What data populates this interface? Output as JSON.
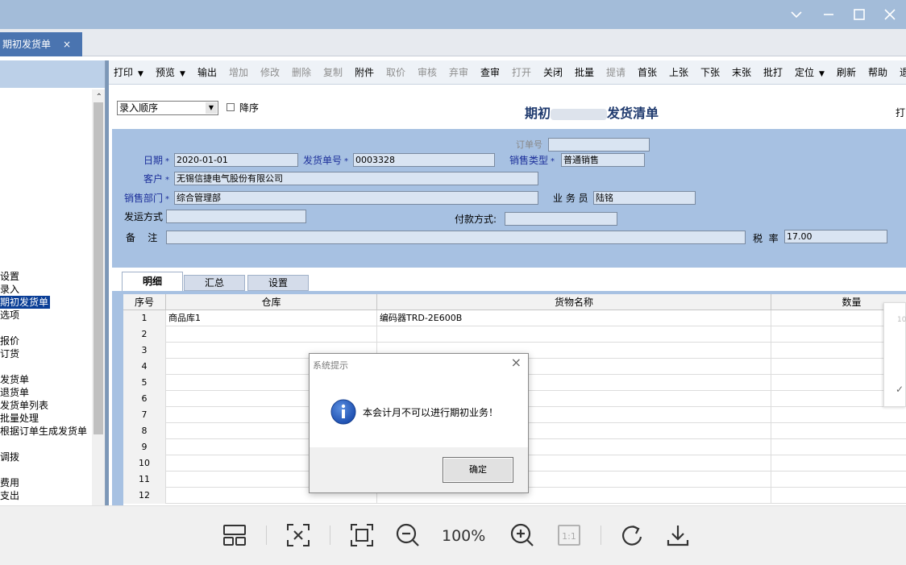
{
  "document_tab": {
    "label": "期初发货单",
    "close": "×"
  },
  "nav_items": [
    "设置",
    "录入",
    "期初发货单",
    "选项",
    "报价",
    "订货",
    "发货单",
    "退货单",
    "发货单列表",
    "批量处理",
    "根据订单生成发货单",
    "调拨",
    "费用",
    "支出"
  ],
  "nav_selected": "期初发货单",
  "toolbar": [
    {
      "label": "打印",
      "enabled": true,
      "dropdown": true
    },
    {
      "label": "预览",
      "enabled": true,
      "dropdown": true
    },
    {
      "label": "输出",
      "enabled": true
    },
    {
      "label": "增加",
      "enabled": false
    },
    {
      "label": "修改",
      "enabled": false
    },
    {
      "label": "删除",
      "enabled": false
    },
    {
      "label": "复制",
      "enabled": false
    },
    {
      "label": "附件",
      "enabled": true
    },
    {
      "label": "取价",
      "enabled": false
    },
    {
      "label": "审核",
      "enabled": false
    },
    {
      "label": "弃审",
      "enabled": false
    },
    {
      "label": "查审",
      "enabled": true
    },
    {
      "label": "打开",
      "enabled": false
    },
    {
      "label": "关闭",
      "enabled": true
    },
    {
      "label": "批量",
      "enabled": true
    },
    {
      "label": "提请",
      "enabled": false
    },
    {
      "label": "首张",
      "enabled": true
    },
    {
      "label": "上张",
      "enabled": true
    },
    {
      "label": "下张",
      "enabled": true
    },
    {
      "label": "末张",
      "enabled": true
    },
    {
      "label": "批打",
      "enabled": true
    },
    {
      "label": "定位",
      "enabled": true,
      "dropdown": true
    },
    {
      "label": "刷新",
      "enabled": true
    },
    {
      "label": "帮助",
      "enabled": true
    },
    {
      "label": "退",
      "enabled": true
    }
  ],
  "sort": {
    "value": "录入顺序",
    "desc_label": "降序"
  },
  "form_title_left": "期初",
  "form_title_right": "发货清单",
  "print_label": "打",
  "form": {
    "order_no_label": "订单号",
    "order_no": "",
    "date_label": "日期",
    "date": "2020-01-01",
    "ship_no_label": "发货单号",
    "ship_no": "0003328",
    "sales_type_label": "销售类型",
    "sales_type": "普通销售",
    "customer_label": "客户",
    "customer": "无锡信捷电气股份有限公司",
    "dept_label": "销售部门",
    "dept": "综合管理部",
    "salesman_label": "业 务 员",
    "salesman": "陆铭",
    "ship_method_label": "发运方式",
    "ship_method": "",
    "payment_label": "付款方式:",
    "payment": "",
    "remark_label": "备    注",
    "remark": "",
    "tax_label": "税  率",
    "tax": "17.00",
    "required_mark": "*"
  },
  "grid_tabs": [
    "明细",
    "汇总",
    "设置"
  ],
  "grid": {
    "columns": [
      "序号",
      "仓库",
      "货物名称",
      "数量"
    ],
    "rows": [
      [
        "1",
        "商品库1",
        "编码器TRD-2E600B",
        ""
      ],
      [
        "2",
        "",
        "",
        ""
      ],
      [
        "3",
        "",
        "",
        ""
      ],
      [
        "4",
        "",
        "",
        ""
      ],
      [
        "5",
        "",
        "",
        ""
      ],
      [
        "6",
        "",
        "",
        ""
      ],
      [
        "7",
        "",
        "",
        ""
      ],
      [
        "8",
        "",
        "",
        ""
      ],
      [
        "9",
        "",
        "",
        ""
      ],
      [
        "10",
        "",
        "",
        ""
      ],
      [
        "11",
        "",
        "",
        ""
      ],
      [
        "12",
        "",
        "",
        ""
      ]
    ]
  },
  "side_popup": {
    "text1": "10",
    "text2": "✓"
  },
  "dialog": {
    "title": "系统提示",
    "message": "本会计月不可以进行期初业务！",
    "ok": "确定",
    "close": "×"
  },
  "viewer": {
    "zoom": "100%",
    "icons": [
      "layout-icon",
      "fit-width-icon",
      "fullscreen-icon",
      "zoom-out-icon",
      "zoom-in-icon",
      "actual-size-icon",
      "rotate-icon",
      "download-icon"
    ]
  },
  "colors": {
    "titlebar": "#a3bcd9",
    "form_bg": "#a7c1e2",
    "selected_nav": "#0a3e96",
    "label_blue": "#1c2f9a"
  }
}
